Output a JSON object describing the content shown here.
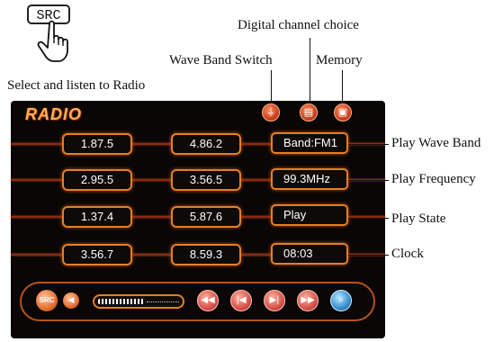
{
  "src_key": {
    "label": "SRC"
  },
  "annotations": {
    "digital_channel": "Digital channel choice",
    "wave_band_switch": "Wave Band  Switch",
    "memory": "Memory",
    "select_listen": "Select and listen to Radio",
    "play_wave_band": "Play Wave Band",
    "play_frequency": "Play Frequency",
    "play_state": "Play State",
    "clock": "Clock"
  },
  "panel": {
    "title": "RADIO",
    "rows": [
      {
        "ch1": "1.87.5",
        "ch2": "4.86.2",
        "info": "Band:FM1"
      },
      {
        "ch1": "2.95.5",
        "ch2": "3.56.5",
        "info": "99.3MHz"
      },
      {
        "ch1": "1.37.4",
        "ch2": "5.87.6",
        "info": "Play"
      },
      {
        "ch1": "3.56.7",
        "ch2": "8.59.3",
        "info": "08:03"
      }
    ],
    "top_icons": [
      "antenna-icon",
      "channel-icon",
      "save-icon"
    ],
    "controls": {
      "src_label": "SRC",
      "volume_level": 0.55,
      "buttons": [
        "rewind-icon",
        "previous-icon",
        "next-icon",
        "fast-forward-icon",
        "search-icon"
      ]
    }
  }
}
